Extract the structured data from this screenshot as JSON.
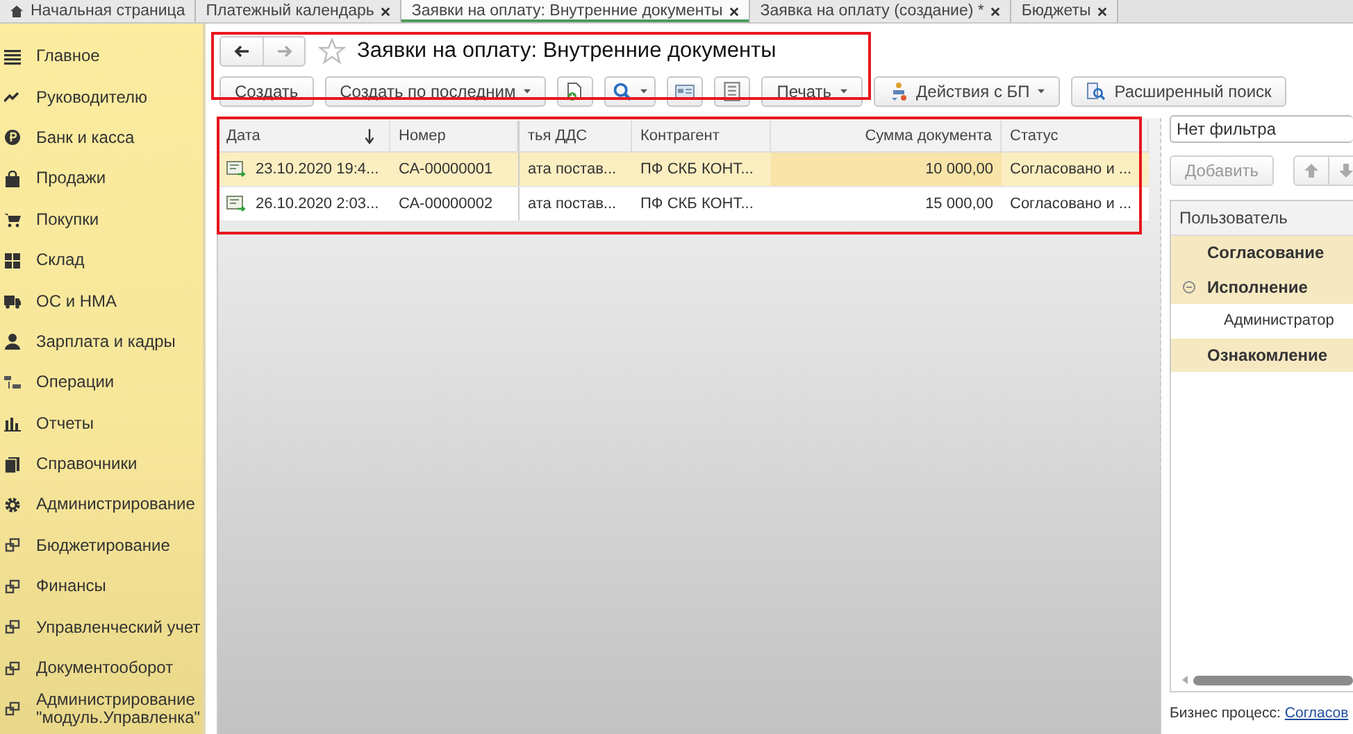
{
  "tabs": [
    {
      "label": "Начальная страница",
      "kind": "home",
      "selected": false
    },
    {
      "label": "Платежный календарь",
      "kind": "closable",
      "selected": false
    },
    {
      "label": "Заявки на оплату: Внутренние документы",
      "kind": "closable",
      "selected": true
    },
    {
      "label": "Заявка на оплату (создание) *",
      "kind": "closable",
      "selected": false
    },
    {
      "label": "Бюджеты",
      "kind": "closable",
      "selected": false
    }
  ],
  "sidebar": {
    "items": [
      {
        "label": "Главное",
        "kind": "menu"
      },
      {
        "label": "Руководителю",
        "kind": "trend"
      },
      {
        "label": "Банк и касса",
        "kind": "coin"
      },
      {
        "label": "Продажи",
        "kind": "bag"
      },
      {
        "label": "Покупки",
        "kind": "cart"
      },
      {
        "label": "Склад",
        "kind": "grid"
      },
      {
        "label": "ОС и НМА",
        "kind": "truck"
      },
      {
        "label": "Зарплата и кадры",
        "kind": "person"
      },
      {
        "label": "Операции",
        "kind": "ledger"
      },
      {
        "label": "Отчеты",
        "kind": "bars"
      },
      {
        "label": "Справочники",
        "kind": "books"
      },
      {
        "label": "Администрирование",
        "kind": "gear"
      },
      {
        "label": "Бюджетирование",
        "kind": "link"
      },
      {
        "label": "Финансы",
        "kind": "link"
      },
      {
        "label": "Управленческий учет",
        "kind": "link"
      },
      {
        "label": "Документооборот",
        "kind": "link"
      },
      {
        "label": "Администрирование \"модуль.Управленка\"",
        "kind": "link"
      }
    ]
  },
  "form": {
    "title": "Заявки на оплату: Внутренние документы",
    "favorite": false,
    "toolbar": [
      {
        "kind": "text",
        "label": "Создать",
        "dropdown": false
      },
      {
        "kind": "text",
        "label": "Создать по последним",
        "dropdown": true
      },
      {
        "kind": "copy",
        "dropdown": false
      },
      {
        "kind": "search",
        "dropdown": true
      },
      {
        "kind": "card",
        "dropdown": false
      },
      {
        "kind": "list",
        "dropdown": false
      },
      {
        "kind": "text",
        "label": "Печать",
        "dropdown": true
      },
      {
        "kind": "process",
        "label": "Действия с БП",
        "dropdown": true
      },
      {
        "kind": "find",
        "label": "Расширенный поиск",
        "dropdown": false
      }
    ]
  },
  "table": {
    "columns": [
      {
        "label": "Дата",
        "sorted": true
      },
      {
        "label": "Номер",
        "sorted": false
      },
      {
        "label": "тья ДДС",
        "sorted": false
      },
      {
        "label": "Контрагент",
        "sorted": false
      },
      {
        "label": "Сумма документа",
        "sorted": false
      },
      {
        "label": "Статус",
        "sorted": false
      }
    ],
    "rows": [
      {
        "selected": true,
        "cells": [
          "23.10.2020 19:4...",
          "СА-00000001",
          "ата постав...",
          "ПФ СКБ КОНТ...",
          "10 000,00",
          "Согласовано и ..."
        ]
      },
      {
        "selected": false,
        "cells": [
          "26.10.2020 2:03...",
          "СА-00000002",
          "ата постав...",
          "ПФ СКБ КОНТ...",
          "15 000,00",
          "Согласовано и ..."
        ]
      }
    ]
  },
  "side_panel": {
    "filter": "Нет фильтра",
    "add_button": {
      "label": "Добавить",
      "disabled": true
    },
    "tree": {
      "column": "Пользователь",
      "items": [
        {
          "label": "Согласование",
          "group": true
        },
        {
          "label": "Исполнение",
          "group": true,
          "expanded": true,
          "children": [
            {
              "label": "Администратор",
              "group": false
            }
          ]
        },
        {
          "label": "Ознакомление",
          "group": true
        }
      ]
    },
    "process_label": "Бизнес процесс:",
    "process_link": "Согласов"
  }
}
